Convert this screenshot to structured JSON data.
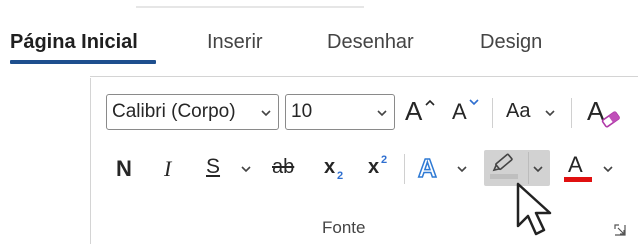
{
  "ribbon": {
    "tabs": [
      {
        "label": "Página Inicial",
        "active": true
      },
      {
        "label": "Inserir",
        "active": false
      },
      {
        "label": "Desenhar",
        "active": false
      },
      {
        "label": "Design",
        "active": false
      }
    ],
    "accent_color": "#1e4f8e"
  },
  "font_group": {
    "font_name_value": "Calibri (Corpo)",
    "font_size_value": "10",
    "grow_font_label": "A",
    "shrink_font_label": "A",
    "change_case_label": "Aa",
    "bold_label": "N",
    "italic_label": "I",
    "underline_label": "S",
    "strikethrough_label": "ab",
    "subscript_base": "x",
    "subscript_sub": "2",
    "superscript_base": "x",
    "superscript_sup": "2",
    "text_effects_label": "A",
    "font_color_label": "A",
    "group_label": "Fonte",
    "colors": {
      "text_effects": "#2f7ad4",
      "highlight": "#bfbfbf",
      "font_color": "#e01010"
    }
  }
}
